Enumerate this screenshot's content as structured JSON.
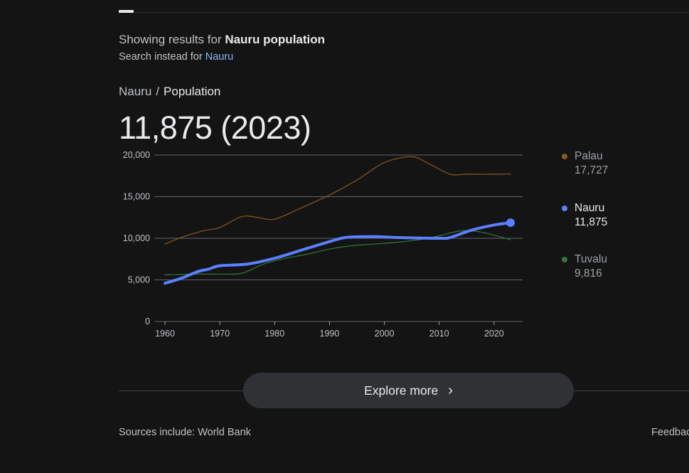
{
  "header": {
    "showing_prefix": "Showing results for",
    "showing_query": "Nauru population",
    "instead_prefix": "Search instead for",
    "instead_query": "Nauru"
  },
  "breadcrumb": {
    "parent": "Nauru",
    "separator": "/",
    "current": "Population"
  },
  "headline": "11,875 (2023)",
  "legend": [
    {
      "name": "Palau",
      "value": "17,727",
      "color": "#8a5a1f"
    },
    {
      "name": "Nauru",
      "value": "11,875",
      "color": "#5a80ff"
    },
    {
      "name": "Tuvalu",
      "value": "9,816",
      "color": "#2f7a3a"
    }
  ],
  "explore": {
    "label": "Explore more",
    "icon": "chevron-right-icon"
  },
  "footer": {
    "sources": "Sources include: World Bank",
    "feedback": "Feedback"
  },
  "chart_data": {
    "type": "line",
    "title": "",
    "xlabel": "",
    "ylabel": "",
    "xlim": [
      1960,
      2023
    ],
    "ylim": [
      0,
      20000
    ],
    "x_ticks": [
      1960,
      1970,
      1980,
      1990,
      2000,
      2010,
      2020
    ],
    "y_ticks": [
      0,
      5000,
      10000,
      15000,
      20000
    ],
    "y_tick_labels": [
      "0",
      "5,000",
      "10,000",
      "15,000",
      "20,000"
    ],
    "grid": true,
    "series": [
      {
        "name": "Palau",
        "color": "#8a5a1f",
        "x": [
          1960,
          1963,
          1967,
          1970,
          1974,
          1977,
          1980,
          1985,
          1990,
          1995,
          2000,
          2005,
          2008,
          2012,
          2015,
          2020,
          2023
        ],
        "values": [
          9300,
          10100,
          10900,
          11300,
          12600,
          12500,
          12300,
          13700,
          15200,
          17000,
          19100,
          19800,
          19000,
          17700,
          17700,
          17700,
          17727
        ]
      },
      {
        "name": "Nauru",
        "color": "#5a80ff",
        "x": [
          1960,
          1963,
          1966,
          1968,
          1970,
          1975,
          1980,
          1985,
          1990,
          1993,
          1998,
          2002,
          2010,
          2012,
          2016,
          2020,
          2023
        ],
        "values": [
          4600,
          5200,
          6000,
          6300,
          6700,
          6900,
          7600,
          8600,
          9600,
          10100,
          10200,
          10100,
          10000,
          10100,
          11000,
          11600,
          11875
        ]
      },
      {
        "name": "Tuvalu",
        "color": "#2f7a3a",
        "x": [
          1960,
          1965,
          1970,
          1974,
          1978,
          1982,
          1986,
          1990,
          1994,
          1998,
          2002,
          2006,
          2010,
          2014,
          2018,
          2023
        ],
        "values": [
          5600,
          5700,
          5700,
          5800,
          6900,
          7600,
          8100,
          8700,
          9100,
          9300,
          9500,
          9800,
          10300,
          10900,
          10700,
          9816
        ]
      }
    ]
  }
}
